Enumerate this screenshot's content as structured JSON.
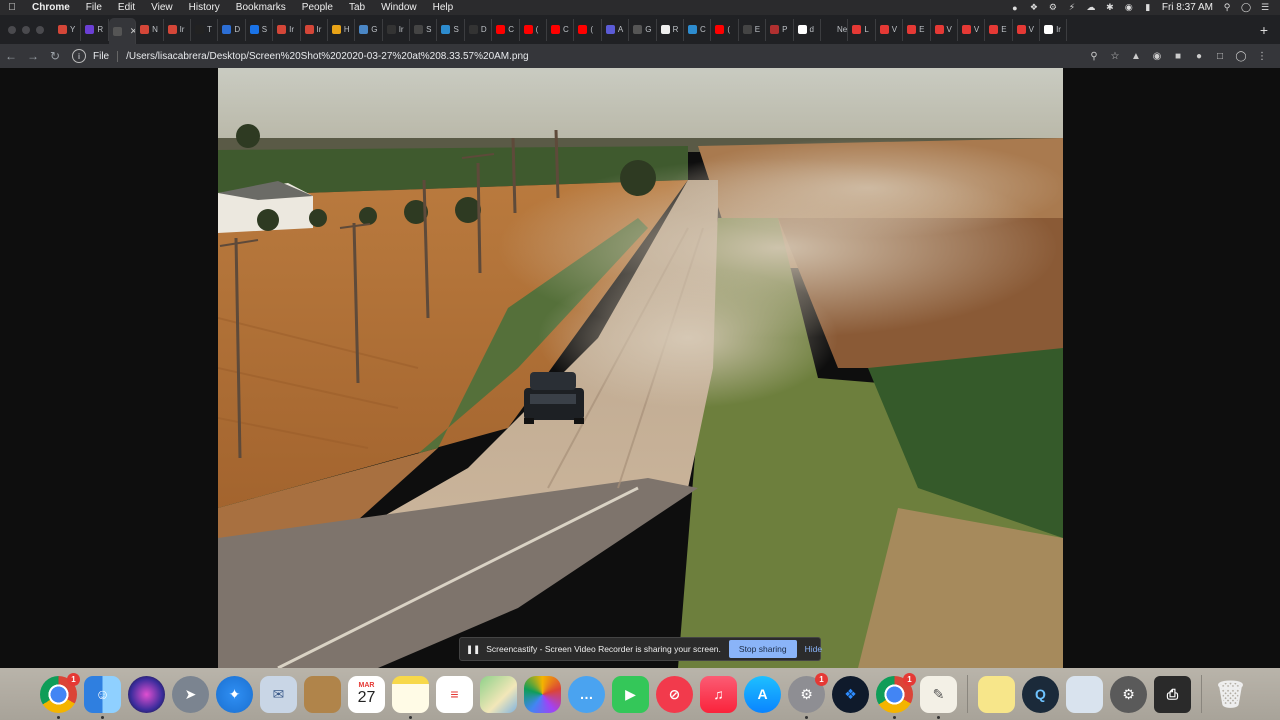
{
  "menubar": {
    "app": "Chrome",
    "menus": [
      "File",
      "Edit",
      "View",
      "History",
      "Bookmarks",
      "People",
      "Tab",
      "Window",
      "Help"
    ],
    "clock": "Fri 8:37 AM"
  },
  "tabs": [
    {
      "label": "Y",
      "color": "#d44638"
    },
    {
      "label": "R",
      "color": "#6b3fd4"
    },
    {
      "label": "",
      "color": "#555555",
      "active": true
    },
    {
      "label": "N",
      "color": "#d44638"
    },
    {
      "label": "Ir",
      "color": "#d44638"
    },
    {
      "label": "T",
      "color": "#222222"
    },
    {
      "label": "D",
      "color": "#2c6ed5"
    },
    {
      "label": "S",
      "color": "#1a73e8"
    },
    {
      "label": "Ir",
      "color": "#d44638"
    },
    {
      "label": "Ir",
      "color": "#d44638"
    },
    {
      "label": "H",
      "color": "#e8a317"
    },
    {
      "label": "G",
      "color": "#4a86c5"
    },
    {
      "label": "Ir",
      "color": "#333333"
    },
    {
      "label": "S",
      "color": "#444444"
    },
    {
      "label": "S",
      "color": "#2d8ccf"
    },
    {
      "label": "D",
      "color": "#333333"
    },
    {
      "label": "C",
      "color": "#ff0000"
    },
    {
      "label": "(",
      "color": "#ff0000"
    },
    {
      "label": "C",
      "color": "#ff0000"
    },
    {
      "label": "(",
      "color": "#ff0000"
    },
    {
      "label": "A",
      "color": "#5b5bd6"
    },
    {
      "label": "G",
      "color": "#555555"
    },
    {
      "label": "R",
      "color": "#eeeeee"
    },
    {
      "label": "C",
      "color": "#2d8ccf"
    },
    {
      "label": "(",
      "color": "#ff0000"
    },
    {
      "label": "E",
      "color": "#444444"
    },
    {
      "label": "P",
      "color": "#b03030"
    },
    {
      "label": "d",
      "color": "#ffffff"
    },
    {
      "label": "New",
      "color": "#202124"
    },
    {
      "label": "L",
      "color": "#e53935"
    },
    {
      "label": "V",
      "color": "#e53935"
    },
    {
      "label": "E",
      "color": "#e53935"
    },
    {
      "label": "V",
      "color": "#e53935"
    },
    {
      "label": "V",
      "color": "#e53935"
    },
    {
      "label": "E",
      "color": "#e53935"
    },
    {
      "label": "V",
      "color": "#e53935"
    },
    {
      "label": "Ir",
      "color": "#ffffff"
    }
  ],
  "toolbar": {
    "scheme": "File",
    "url": "/Users/lisacabrera/Desktop/Screen%20Shot%202020-03-27%20at%208.33.57%20AM.png"
  },
  "share": {
    "message": "Screencastify - Screen Video Recorder is sharing your screen.",
    "stop_label": "Stop sharing",
    "hide_label": "Hide"
  },
  "dock": {
    "calendar_month": "MAR",
    "calendar_day": "27",
    "chrome_badge": "1",
    "prefs_badge": "1",
    "chrome2_badge": "1"
  },
  "colors": {
    "accent": "#8ab4f8",
    "tab_bg": "#202124",
    "toolbar_bg": "#35363a"
  }
}
